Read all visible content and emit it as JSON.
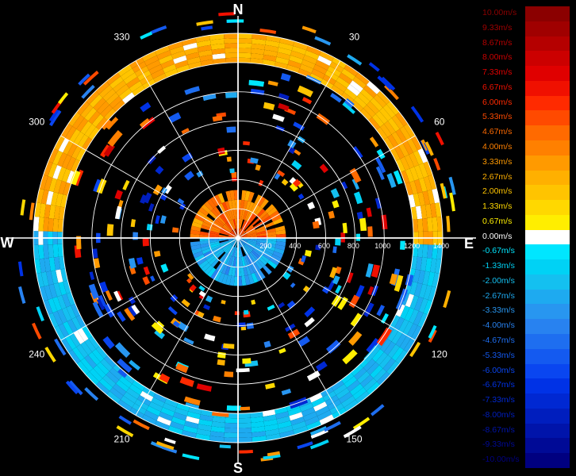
{
  "chart_data": {
    "type": "polar-radar",
    "compass": {
      "north": "N",
      "south": "S",
      "east": "E",
      "west": "W"
    },
    "azimuth_labels": [
      "30",
      "60",
      "120",
      "150",
      "210",
      "240",
      "300",
      "330"
    ],
    "azimuth_values": [
      30,
      60,
      120,
      150,
      210,
      240,
      300,
      330
    ],
    "range_labels": [
      "200",
      "400",
      "600",
      "800",
      "1000",
      "1200",
      "1400"
    ],
    "range_values": [
      200,
      400,
      600,
      800,
      1000,
      1200,
      1400
    ],
    "range_max": 1400,
    "ring_bands": [
      {
        "inner": 1200,
        "outer": 1400,
        "note": "strong return ring"
      },
      {
        "inner": 0,
        "outer": 400,
        "note": "near-field return"
      }
    ],
    "velocity_pattern": {
      "north_sector_value": 2.67,
      "south_sector_value": -2.0,
      "near_field_north_value": 5.33,
      "near_field_south_value": -2.67
    },
    "colorbar": {
      "unit": "m/s",
      "levels": [
        {
          "label": "10.00m/s",
          "value": 10.0,
          "color": "#8b0000"
        },
        {
          "label": "9.33m/s",
          "value": 9.33,
          "color": "#a00000"
        },
        {
          "label": "8.67m/s",
          "value": 8.67,
          "color": "#b50000"
        },
        {
          "label": "8.00m/s",
          "value": 8.0,
          "color": "#cc0000"
        },
        {
          "label": "7.33m/s",
          "value": 7.33,
          "color": "#e00000"
        },
        {
          "label": "6.67m/s",
          "value": 6.67,
          "color": "#f01000"
        },
        {
          "label": "6.00m/s",
          "value": 6.0,
          "color": "#ff2a00"
        },
        {
          "label": "5.33m/s",
          "value": 5.33,
          "color": "#ff4a00"
        },
        {
          "label": "4.67m/s",
          "value": 4.67,
          "color": "#ff6a00"
        },
        {
          "label": "4.00m/s",
          "value": 4.0,
          "color": "#ff8000"
        },
        {
          "label": "3.33m/s",
          "value": 3.33,
          "color": "#ff9a00"
        },
        {
          "label": "2.67m/s",
          "value": 2.67,
          "color": "#ffb000"
        },
        {
          "label": "2.00m/s",
          "value": 2.0,
          "color": "#ffc400"
        },
        {
          "label": "1.33m/s",
          "value": 1.33,
          "color": "#ffd800"
        },
        {
          "label": "0.67m/s",
          "value": 0.67,
          "color": "#ffee00"
        },
        {
          "label": "0.00m/s",
          "value": 0.0,
          "color": "#ffffff"
        },
        {
          "label": "-0.67m/s",
          "value": -0.67,
          "color": "#00e6ff"
        },
        {
          "label": "-1.33m/s",
          "value": -1.33,
          "color": "#00d2f5"
        },
        {
          "label": "-2.00m/s",
          "value": -2.0,
          "color": "#14c0f0"
        },
        {
          "label": "-2.67m/s",
          "value": -2.67,
          "color": "#1eaaf0"
        },
        {
          "label": "-3.33m/s",
          "value": -3.33,
          "color": "#2896f0"
        },
        {
          "label": "-4.00m/s",
          "value": -4.0,
          "color": "#2882f0"
        },
        {
          "label": "-4.67m/s",
          "value": -4.67,
          "color": "#1e6ef0"
        },
        {
          "label": "-5.33m/s",
          "value": -5.33,
          "color": "#145af0"
        },
        {
          "label": "-6.00m/s",
          "value": -6.0,
          "color": "#0a46f0"
        },
        {
          "label": "-6.67m/s",
          "value": -6.67,
          "color": "#0032e6"
        },
        {
          "label": "-7.33m/s",
          "value": -7.33,
          "color": "#0028d2"
        },
        {
          "label": "-8.00m/s",
          "value": -8.0,
          "color": "#001ebe"
        },
        {
          "label": "-8.67m/s",
          "value": -8.67,
          "color": "#0014aa"
        },
        {
          "label": "-9.33m/s",
          "value": -9.33,
          "color": "#000a96"
        },
        {
          "label": "-10.00m/s",
          "value": -10.0,
          "color": "#000080"
        }
      ]
    },
    "grid": true,
    "legend_position": "right"
  }
}
